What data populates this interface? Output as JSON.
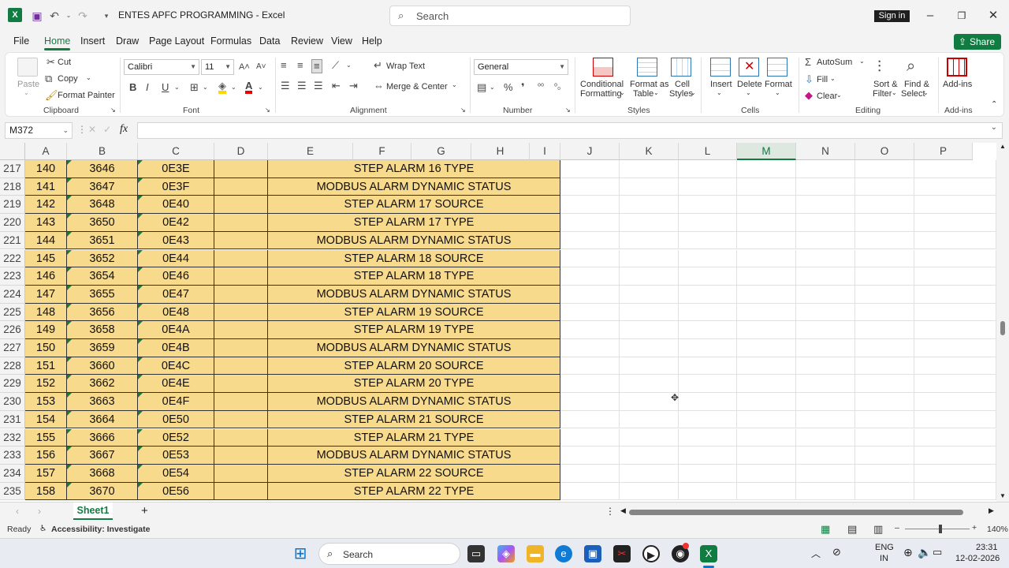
{
  "titlebar": {
    "doc_title": "ENTES APFC PROGRAMMING  -  Excel",
    "search_placeholder": "Search",
    "signin_label": "Sign in"
  },
  "menu": {
    "tabs": [
      "File",
      "Home",
      "Insert",
      "Draw",
      "Page Layout",
      "Formulas",
      "Data",
      "Review",
      "View",
      "Help"
    ],
    "active": "Home",
    "share_label": "Share"
  },
  "ribbon": {
    "clipboard": {
      "paste": "Paste",
      "cut": "Cut",
      "copy": "Copy",
      "format_painter": "Format Painter",
      "label": "Clipboard"
    },
    "font": {
      "name": "Calibri",
      "size": "11",
      "label": "Font",
      "bold": "B",
      "italic": "I",
      "underline": "U"
    },
    "alignment": {
      "wrap_text": "Wrap Text",
      "merge_center": "Merge & Center",
      "label": "Alignment"
    },
    "number": {
      "format": "General",
      "label": "Number"
    },
    "styles": {
      "conditional_1": "Conditional",
      "conditional_2": "Formatting",
      "format_table_1": "Format as",
      "format_table_2": "Table",
      "cell_styles_1": "Cell",
      "cell_styles_2": "Styles",
      "label": "Styles"
    },
    "cells": {
      "insert": "Insert",
      "delete": "Delete",
      "format": "Format",
      "label": "Cells"
    },
    "editing": {
      "autosum": "AutoSum",
      "fill": "Fill",
      "clear": "Clear",
      "sort_1": "Sort &",
      "sort_2": "Filter",
      "find_1": "Find &",
      "find_2": "Select",
      "label": "Editing"
    },
    "addins": {
      "name": "Add-ins",
      "label": "Add-ins"
    }
  },
  "formula_bar": {
    "name_box": "M372",
    "fx": "fx",
    "content": ""
  },
  "grid": {
    "columns": [
      "A",
      "B",
      "C",
      "D",
      "E",
      "F",
      "G",
      "H",
      "I",
      "J",
      "K",
      "L",
      "M",
      "N",
      "O",
      "P"
    ],
    "selected_column": "M",
    "rows": [
      {
        "num": "217",
        "a": "140",
        "b": "3646",
        "c": "0E3E",
        "e": "STEP ALARM 16 TYPE"
      },
      {
        "num": "218",
        "a": "141",
        "b": "3647",
        "c": "0E3F",
        "e": "MODBUS ALARM DYNAMIC STATUS"
      },
      {
        "num": "219",
        "a": "142",
        "b": "3648",
        "c": "0E40",
        "e": "STEP ALARM 17 SOURCE"
      },
      {
        "num": "220",
        "a": "143",
        "b": "3650",
        "c": "0E42",
        "e": "STEP ALARM 17 TYPE"
      },
      {
        "num": "221",
        "a": "144",
        "b": "3651",
        "c": "0E43",
        "e": "MODBUS ALARM DYNAMIC STATUS"
      },
      {
        "num": "222",
        "a": "145",
        "b": "3652",
        "c": "0E44",
        "e": "STEP ALARM 18 SOURCE"
      },
      {
        "num": "223",
        "a": "146",
        "b": "3654",
        "c": "0E46",
        "e": "STEP ALARM 18 TYPE"
      },
      {
        "num": "224",
        "a": "147",
        "b": "3655",
        "c": "0E47",
        "e": "MODBUS ALARM DYNAMIC STATUS"
      },
      {
        "num": "225",
        "a": "148",
        "b": "3656",
        "c": "0E48",
        "e": "STEP ALARM 19 SOURCE"
      },
      {
        "num": "226",
        "a": "149",
        "b": "3658",
        "c": "0E4A",
        "e": "STEP ALARM 19 TYPE"
      },
      {
        "num": "227",
        "a": "150",
        "b": "3659",
        "c": "0E4B",
        "e": "MODBUS ALARM DYNAMIC STATUS"
      },
      {
        "num": "228",
        "a": "151",
        "b": "3660",
        "c": "0E4C",
        "e": "STEP ALARM 20 SOURCE"
      },
      {
        "num": "229",
        "a": "152",
        "b": "3662",
        "c": "0E4E",
        "e": "STEP ALARM 20 TYPE"
      },
      {
        "num": "230",
        "a": "153",
        "b": "3663",
        "c": "0E4F",
        "e": "MODBUS ALARM DYNAMIC STATUS"
      },
      {
        "num": "231",
        "a": "154",
        "b": "3664",
        "c": "0E50",
        "e": "STEP ALARM 21 SOURCE"
      },
      {
        "num": "232",
        "a": "155",
        "b": "3666",
        "c": "0E52",
        "e": "STEP ALARM 21 TYPE"
      },
      {
        "num": "233",
        "a": "156",
        "b": "3667",
        "c": "0E53",
        "e": "MODBUS ALARM DYNAMIC STATUS"
      },
      {
        "num": "234",
        "a": "157",
        "b": "3668",
        "c": "0E54",
        "e": "STEP ALARM 22 SOURCE"
      },
      {
        "num": "235",
        "a": "158",
        "b": "3670",
        "c": "0E56",
        "e": "STEP ALARM 22 TYPE"
      }
    ]
  },
  "sheets": {
    "tabs": [
      "Sheet1"
    ],
    "add": "+"
  },
  "status": {
    "ready": "Ready",
    "accessibility": "Accessibility: Investigate",
    "zoom": "140%"
  },
  "taskbar": {
    "search_label": "Search",
    "lang_1": "ENG",
    "lang_2": "IN",
    "time": "23:31",
    "date": "12-02-2026"
  },
  "colors": {
    "excel_green": "#107c41",
    "cell_fill": "#f8da8d"
  }
}
